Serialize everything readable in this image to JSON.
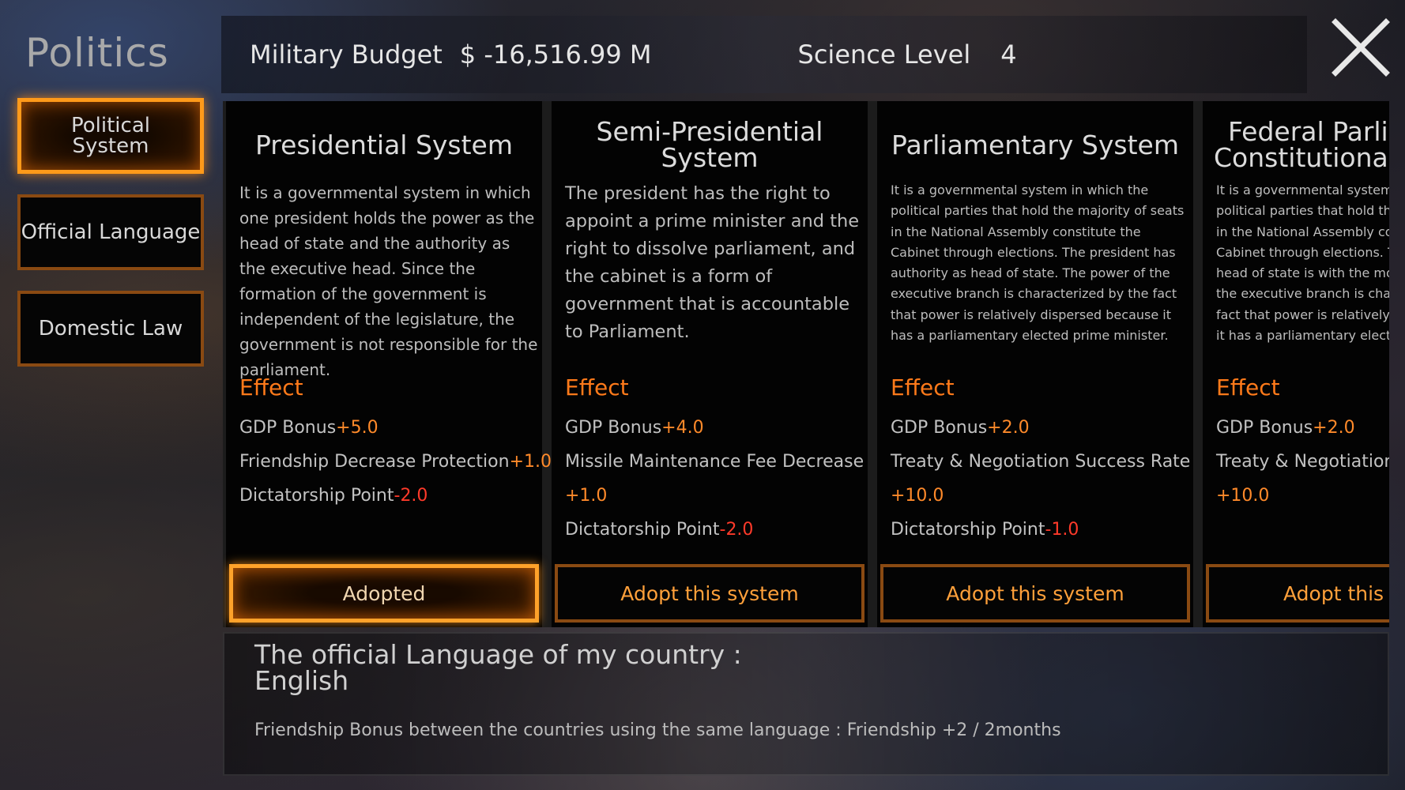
{
  "sidebar": {
    "title": "Politics",
    "items": [
      {
        "line1": "Political",
        "line2": "System",
        "active": true
      },
      {
        "label": "Official Language"
      },
      {
        "label": "Domestic Law"
      }
    ]
  },
  "header": {
    "budget_label": "Military Budget",
    "budget_value": "$ -16,516.99 M",
    "science_label": "Science Level",
    "science_value": "4"
  },
  "effect_label": "Effect",
  "cards": [
    {
      "title": "Presidential System",
      "description": "It is a governmental system in which one president holds the power as the head of state and the authority as the executive head. Since the formation of the government is independent of the legislature, the government is not responsible for the parliament.",
      "effects": [
        {
          "name": "GDP Bonus",
          "value": "+5.0"
        },
        {
          "name": "Friendship Decrease Protection",
          "value": "+1.0"
        },
        {
          "name": "Dictatorship Point",
          "value": "-2.0"
        }
      ],
      "button": "Adopted"
    },
    {
      "title": "Semi-Presidential System",
      "description": "The president has the right to appoint a prime minister and the right to dissolve parliament, and the cabinet is a form of government that is accountable to Parliament.",
      "effects": [
        {
          "name": "GDP Bonus",
          "value": "+4.0"
        },
        {
          "name": "Missile Maintenance Fee Decrease",
          "value": "+1.0"
        },
        {
          "name": "Dictatorship Point",
          "value": "-2.0"
        }
      ],
      "button": "Adopt this system"
    },
    {
      "title": "Parliamentary System",
      "description": "It is a governmental system in which the political parties that hold the majority of seats in the National Assembly constitute the Cabinet through elections. The president has authority as head of state. The power of the executive branch is characterized by the fact that power is relatively dispersed because it has a parliamentary elected prime minister.",
      "effects": [
        {
          "name": "GDP Bonus",
          "value": "+2.0"
        },
        {
          "name": "Treaty & Negotiation Success Rate",
          "value": "+10.0"
        },
        {
          "name": "Dictatorship Point",
          "value": "-1.0"
        }
      ],
      "button": "Adopt this system"
    },
    {
      "title_line1": "Federal Parlia",
      "title_line2": "Constitutional",
      "desc_lines": [
        "It is a governmental system i",
        "political parties that hold th",
        "in the National Assembly co",
        "Cabinet through elections. T",
        "head of state is with the mo",
        "the executive branch is chara",
        "fact that power is relatively c",
        "it has a parliamentary electe"
      ],
      "effects": [
        {
          "name": "GDP Bonus",
          "value": "+2.0"
        },
        {
          "name": "Treaty & Negotiation",
          "value": "+10.0"
        }
      ],
      "button": "Adopt this sy"
    }
  ],
  "language": {
    "title_line1": "The official Language of my country :",
    "title_line2": "English",
    "bonus": "Friendship Bonus between the countries using the same language : Friendship +2 / 2months"
  },
  "colors": {
    "accent_orange": "#ff9a1a",
    "effect_orange": "#ff7a1a",
    "positive": "#ff8a2a",
    "negative": "#ff3a2a",
    "button_text": "#ffa03a"
  }
}
